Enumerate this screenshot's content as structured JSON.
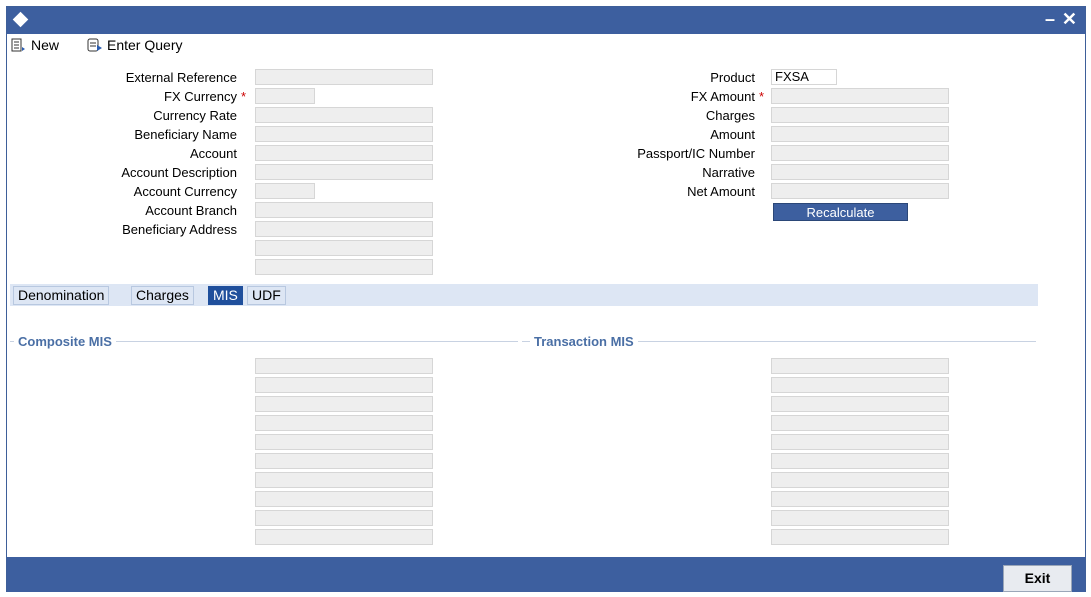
{
  "toolbar": {
    "new_label": "New",
    "enter_query_label": "Enter Query"
  },
  "left_fields": [
    {
      "label": "External Reference",
      "required": false,
      "value": ""
    },
    {
      "label": "FX Currency",
      "required": true,
      "value": ""
    },
    {
      "label": "Currency Rate",
      "required": false,
      "value": ""
    },
    {
      "label": "Beneficiary Name",
      "required": false,
      "value": ""
    },
    {
      "label": "Account",
      "required": false,
      "value": ""
    },
    {
      "label": "Account Description",
      "required": false,
      "value": ""
    },
    {
      "label": "Account Currency",
      "required": false,
      "value": ""
    },
    {
      "label": "Account Branch",
      "required": false,
      "value": ""
    },
    {
      "label": "Beneficiary Address",
      "required": false,
      "value": ""
    }
  ],
  "right_fields": [
    {
      "label": "Product",
      "required": false,
      "value": "FXSA"
    },
    {
      "label": "FX Amount",
      "required": true,
      "value": ""
    },
    {
      "label": "Charges",
      "required": false,
      "value": ""
    },
    {
      "label": "Amount",
      "required": false,
      "value": ""
    },
    {
      "label": "Passport/IC Number",
      "required": false,
      "value": ""
    },
    {
      "label": "Narrative",
      "required": false,
      "value": ""
    },
    {
      "label": "Net Amount",
      "required": false,
      "value": ""
    }
  ],
  "required_marker": "*",
  "recalculate_label": "Recalculate",
  "tabs": [
    "Denomination",
    "Charges",
    "MIS",
    "UDF"
  ],
  "active_tab": "MIS",
  "sections": {
    "composite": "Composite MIS",
    "transaction": "Transaction MIS"
  },
  "footer": {
    "exit_label": "Exit"
  },
  "window_controls": {
    "minimize": "–",
    "close": "✕"
  }
}
